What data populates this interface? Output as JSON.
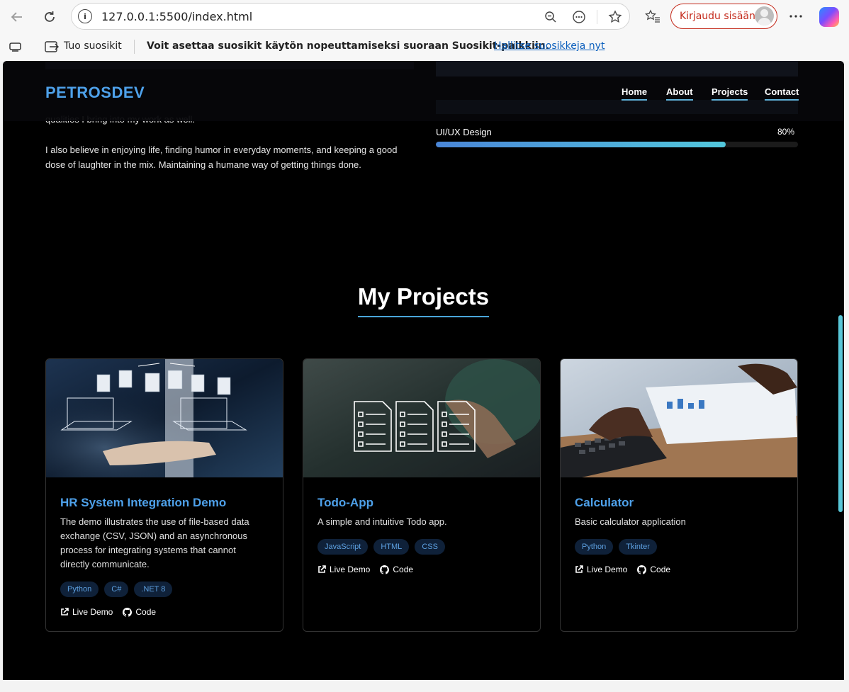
{
  "browser": {
    "url": "127.0.0.1:5500/index.html",
    "signin_label": "Kirjaudu sisään",
    "favorites": {
      "import_label": "Tuo suosikit",
      "message": "Voit asettaa suosikit käytön nopeuttamiseksi suoraan Suosikit-palkkiin.",
      "manage_link": "Hallitse suosikkeja nyt"
    }
  },
  "site": {
    "logo": "PETROSDEV",
    "nav": [
      "Home",
      "About",
      "Projects",
      "Contact"
    ],
    "about": {
      "partial_line": "qualities I bring into my work as well.",
      "paragraph": "I also believe in enjoying life, finding humor in everyday moments, and keeping a good dose of laughter in the mix. Maintaining a humane way of getting things done."
    },
    "skill": {
      "name": "UI/UX Design",
      "percent_label": "80%",
      "percent": 80
    },
    "projects_title": "My Projects",
    "projects": [
      {
        "title": "HR System Integration Demo",
        "description": "The demo illustrates the use of file-based data exchange (CSV, JSON) and an asynchronous process for integrating systems that cannot directly communicate.",
        "tags": [
          "Python",
          "C#",
          ".NET 8"
        ],
        "live_label": "Live Demo",
        "code_label": "Code"
      },
      {
        "title": "Todo-App",
        "description": "A simple and intuitive Todo app.",
        "tags": [
          "JavaScript",
          "HTML",
          "CSS"
        ],
        "live_label": "Live Demo",
        "code_label": "Code"
      },
      {
        "title": "Calculator",
        "description": "Basic calculator application",
        "tags": [
          "Python",
          "Tkinter"
        ],
        "live_label": "Live Demo",
        "code_label": "Code"
      }
    ]
  },
  "colors": {
    "accent": "#4ea1ea",
    "tag_bg": "#0f2139",
    "signin": "#c42b1c"
  }
}
